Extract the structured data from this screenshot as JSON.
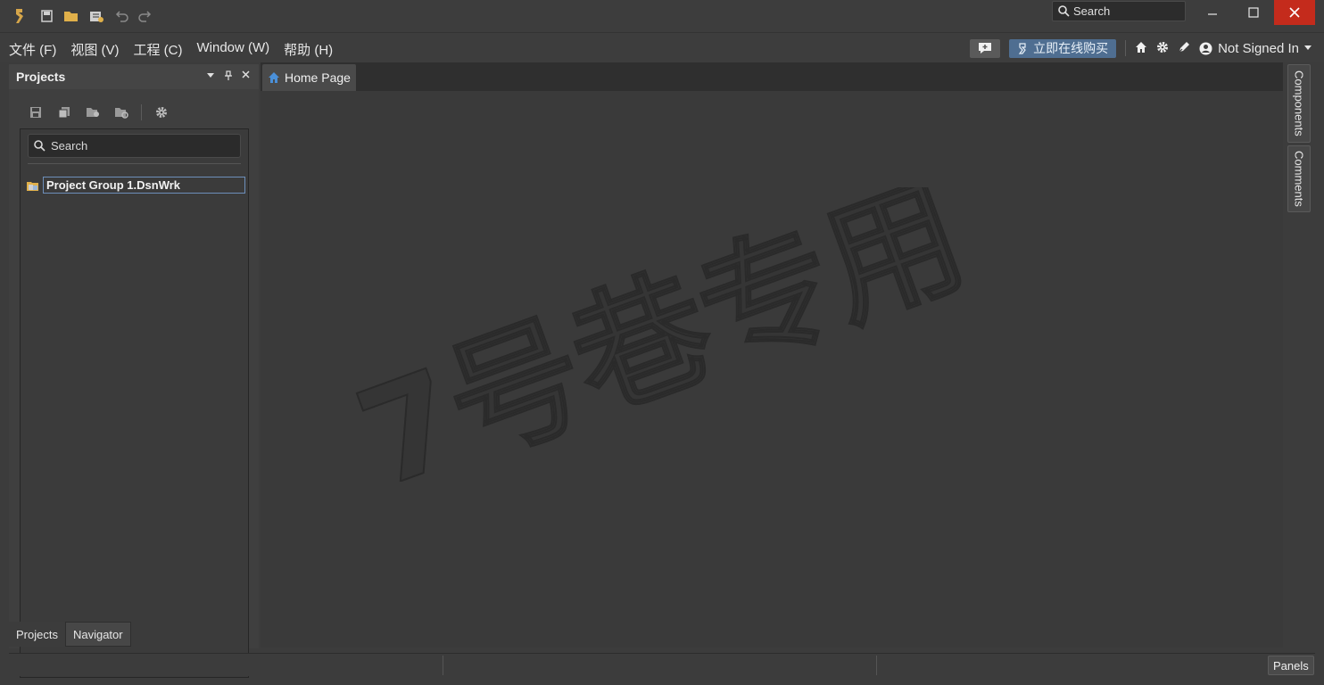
{
  "titlebar": {
    "search_label": "Search",
    "icons": [
      "app-logo-icon",
      "save-all-icon",
      "open-folder-icon",
      "open-project-icon",
      "undo-icon",
      "redo-icon"
    ]
  },
  "menu": {
    "items": [
      "文件 (F)",
      "视图 (V)",
      "工程 (C)",
      "Window (W)",
      "帮助 (H)"
    ]
  },
  "right_tools": {
    "buy_label": "立即在线购买",
    "user_label": "Not Signed In"
  },
  "projects_panel": {
    "title": "Projects",
    "search_placeholder": "Search",
    "tree": [
      "Project Group 1.DsnWrk"
    ],
    "bottom_tabs": [
      "Projects",
      "Navigator"
    ]
  },
  "document": {
    "tab_label": "Home Page",
    "watermark": "7号巷专用"
  },
  "side_tabs": [
    "Components",
    "Comments"
  ],
  "statusbar": {
    "panels_label": "Panels"
  },
  "colors": {
    "close_button": "#c42b1c",
    "accent_chip": "#4f6e91",
    "home_icon": "#4a90d9"
  }
}
